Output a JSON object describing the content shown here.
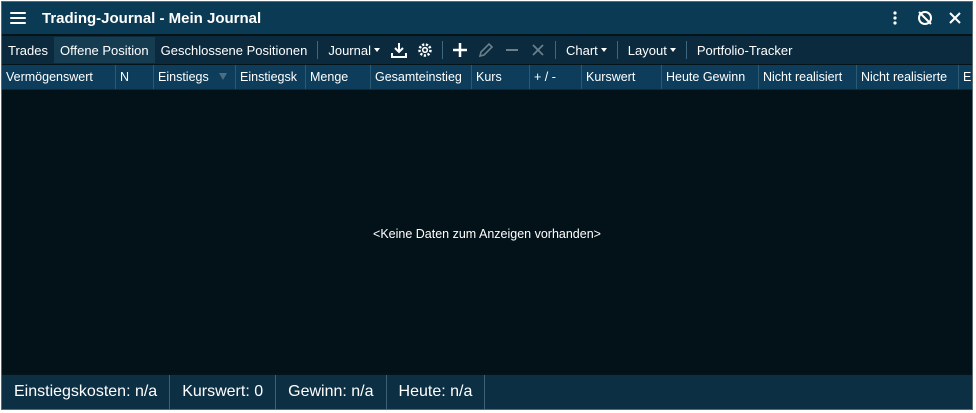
{
  "window": {
    "title": "Trading-Journal - Mein Journal",
    "title_icons": [
      "more-vertical-icon",
      "unlink-icon",
      "close-icon"
    ]
  },
  "toolbar": {
    "tabs": [
      "Trades",
      "Offene Position",
      "Geschlossene Positionen"
    ],
    "active_tab": "Offene Position",
    "journal_label": "Journal",
    "icons": [
      "download-icon",
      "settings-icon",
      "add-icon",
      "edit-icon",
      "remove-icon",
      "delete-icon"
    ],
    "chart_label": "Chart",
    "layout_label": "Layout",
    "portfolio_label": "Portfolio-Tracker"
  },
  "grid": {
    "columns": [
      "Vermögenswert",
      "N",
      "Einstiegs",
      "Einstiegsk",
      "Menge",
      "Gesamteinstieg",
      "Kurs",
      "+ / -",
      "Kurswert",
      "Heute Gewinn",
      "Nicht realisiert",
      "Nicht realisierte",
      "E"
    ],
    "empty_message": "<Keine Daten zum Anzeigen vorhanden>"
  },
  "status": {
    "einstiegskosten": "Einstiegskosten: n/a",
    "kurswert": "Kurswert: 0",
    "gewinn": "Gewinn: n/a",
    "heute": "Heute: n/a"
  },
  "colors": {
    "title_bar": "#0b3a55",
    "toolbar": "#0b2a3d",
    "header": "#0d3d5a",
    "body": "#031218",
    "status": "#0d2f44"
  }
}
